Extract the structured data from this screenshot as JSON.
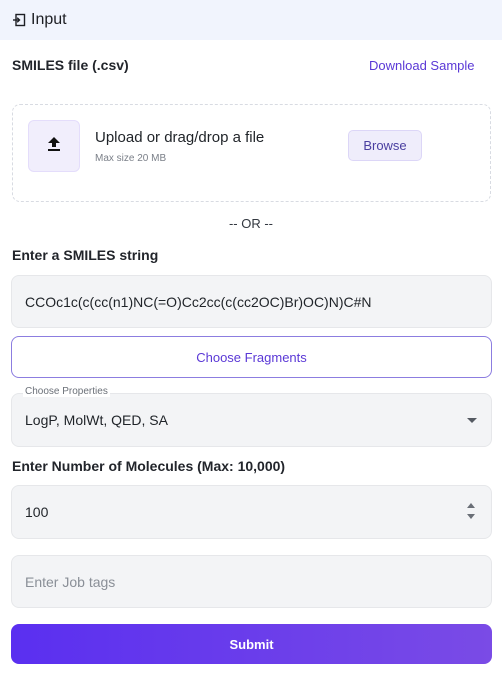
{
  "header": {
    "title": "Input",
    "icon": "login-icon"
  },
  "smiles_file": {
    "label": "SMILES file (.csv)",
    "download_link": "Download Sample",
    "upload_title": "Upload or drag/drop a file",
    "upload_subtitle": "Max size 20 MB",
    "browse_label": "Browse",
    "upload_icon": "upload-icon"
  },
  "separator": "-- OR --",
  "smiles_string": {
    "label": "Enter a SMILES string",
    "value": "CCOc1c(c(cc(n1)NC(=O)Cc2cc(c(cc2OC)Br)OC)N)C#N"
  },
  "fragments": {
    "button_label": "Choose Fragments"
  },
  "properties": {
    "label": "Choose Properties",
    "selected": "LogP, MolWt, QED, SA"
  },
  "molecules": {
    "label": "Enter Number of Molecules (Max: 10,000)",
    "value": "100"
  },
  "job_tags": {
    "placeholder": "Enter Job tags"
  },
  "submit_label": "Submit",
  "colors": {
    "accent": "#5a38d6",
    "header_bg": "#f1f4fd",
    "submit_gradient_start": "#5a2ff0",
    "submit_gradient_end": "#7a4be6",
    "field_bg": "#f3f4f6"
  }
}
